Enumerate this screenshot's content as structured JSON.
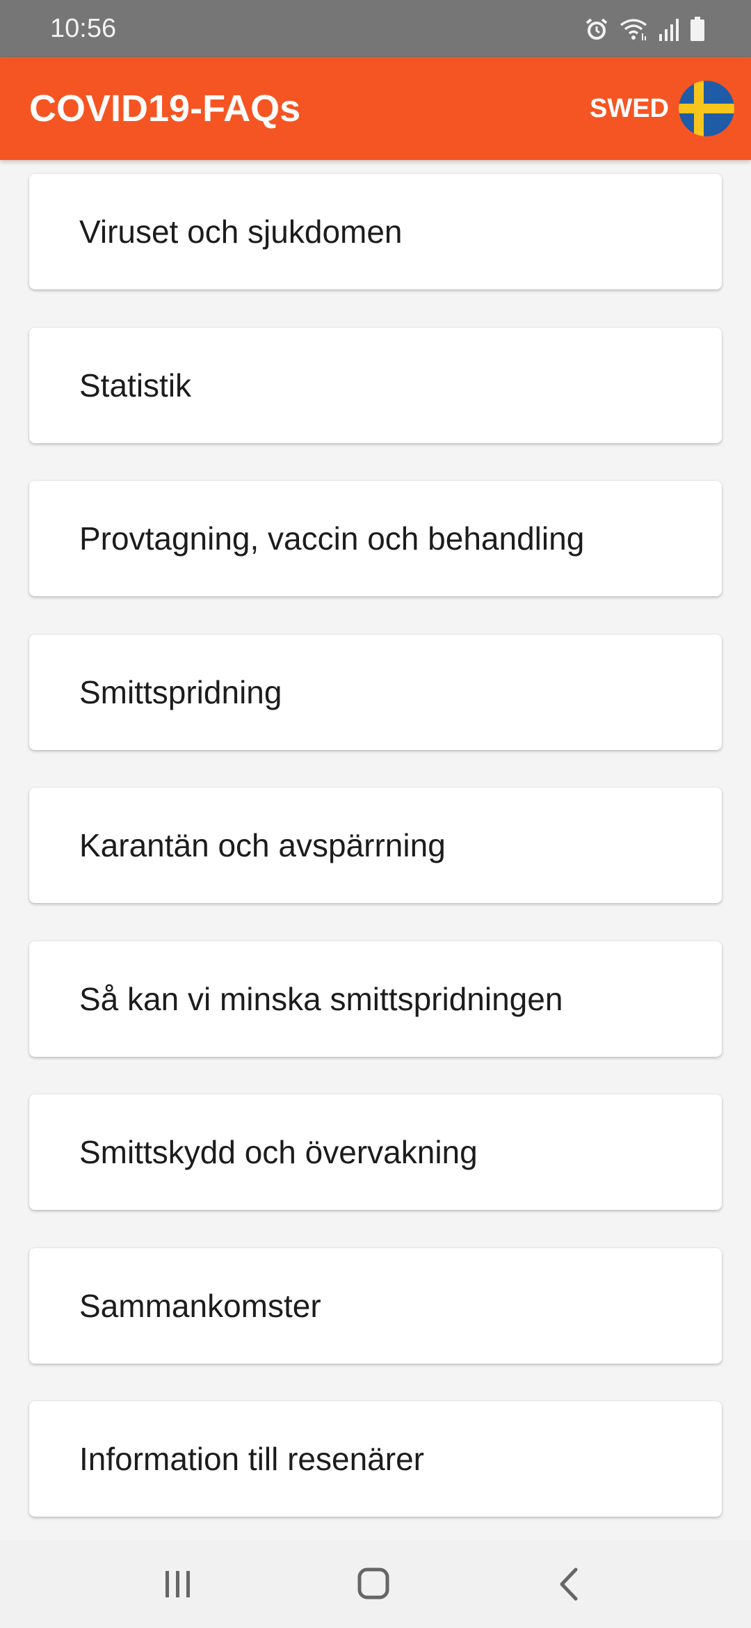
{
  "status_bar": {
    "time": "10:56",
    "icons": [
      "alarm-icon",
      "wifi-icon",
      "signal-icon",
      "battery-icon"
    ]
  },
  "app_bar": {
    "title": "COVID19-FAQs",
    "language_label": "SWED",
    "flag": "sweden-flag-icon",
    "background_color": "#f55523"
  },
  "categories": [
    {
      "label": "Viruset och sjukdomen"
    },
    {
      "label": "Statistik"
    },
    {
      "label": "Provtagning, vaccin och behandling"
    },
    {
      "label": "Smittspridning"
    },
    {
      "label": "Karantän och avspärrning"
    },
    {
      "label": "Så kan vi minska smittspridningen"
    },
    {
      "label": "Smittskydd och övervakning"
    },
    {
      "label": "Sammankomster"
    },
    {
      "label": "Information till resenärer"
    }
  ],
  "nav_bar": {
    "buttons": [
      "recent-apps-icon",
      "home-icon",
      "back-icon"
    ]
  }
}
